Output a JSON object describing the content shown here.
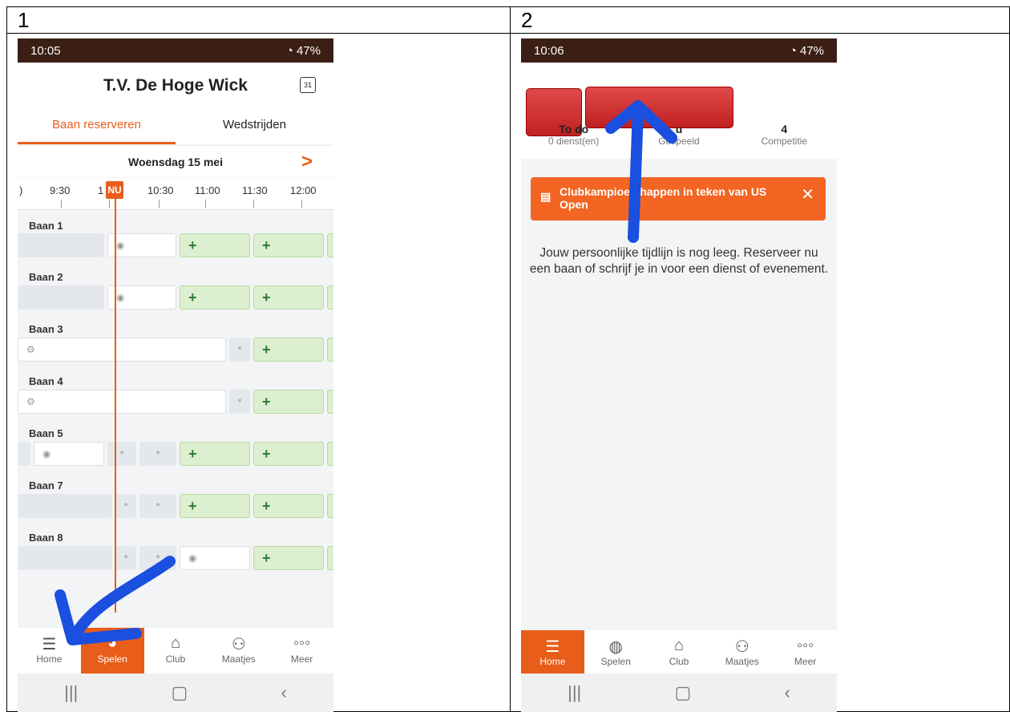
{
  "cells": {
    "left_number": "1",
    "right_number": "2"
  },
  "screen1": {
    "status": {
      "time": "10:05",
      "battery": "47%"
    },
    "title": "T.V. De Hoge Wick",
    "calendar_icon_text": "31",
    "tabs": [
      "Baan reserveren",
      "Wedstrijden"
    ],
    "date": "Woensdag 15 mei",
    "next_arrow": ">",
    "now_label": "NU",
    "times": [
      ")",
      "9:30",
      "1",
      "10:30",
      "11:00",
      "11:30",
      "12:00"
    ],
    "courts": [
      "Baan 1",
      "Baan 2",
      "Baan 3",
      "Baan 4",
      "Baan 5",
      "Baan 7",
      "Baan 8"
    ],
    "plus": "+",
    "nav": [
      "Home",
      "Spelen",
      "Club",
      "Maatjes",
      "Meer"
    ],
    "active_nav": "Spelen"
  },
  "screen2": {
    "status": {
      "time": "10:06",
      "battery": "47%"
    },
    "stats": [
      {
        "value": "To do",
        "label": "0 dienst(en)"
      },
      {
        "value": "u",
        "label": "Gespeeld"
      },
      {
        "value": "4",
        "label": "Competitie"
      }
    ],
    "banner": "Clubkampioen  happen in teken van US Open",
    "banner_close": "✕",
    "empty_message": "Jouw persoonlijke tijdlijn is nog leeg. Reserveer nu een baan of schrijf je in voor een dienst of evenement.",
    "nav": [
      "Home",
      "Spelen",
      "Club",
      "Maatjes",
      "Meer"
    ],
    "active_nav": "Home"
  },
  "colors": {
    "accent": "#e85d1a",
    "status_bar": "#3b1e14",
    "annotation": "#1a4fe0",
    "redaction": "#d03030"
  },
  "icons": [
    "walking-icon",
    "calendar-icon",
    "chevron-right-icon",
    "menu-icon",
    "tennis-ball-icon",
    "home-icon",
    "people-icon",
    "more-icon",
    "close-icon",
    "newspaper-icon"
  ]
}
